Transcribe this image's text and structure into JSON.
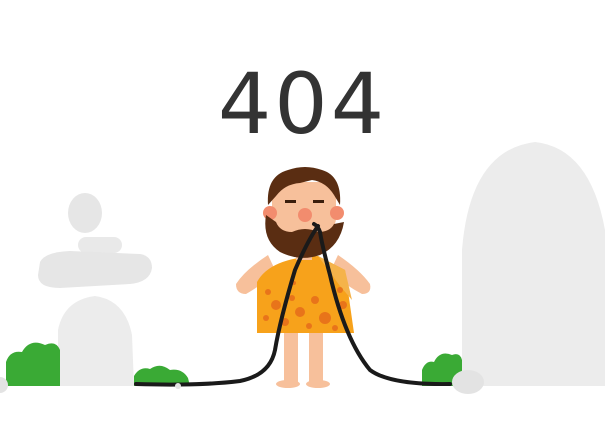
{
  "error": {
    "code": "404"
  },
  "scene": {
    "figure": "caveman-icon",
    "left_decoration": "stacked-rocks-icon",
    "right_decoration": "large-rock-icon",
    "cable": "power-cable-icon",
    "bushes": "bush-icon"
  },
  "colors": {
    "text": "#333333",
    "rock": "#ececec",
    "bush": "#3aaa35",
    "skin": "#f7c09b",
    "beard": "#5a2d12",
    "tunic": "#f7a21b",
    "tunic_spots": "#e8741a",
    "cable": "#1a1a1a"
  }
}
